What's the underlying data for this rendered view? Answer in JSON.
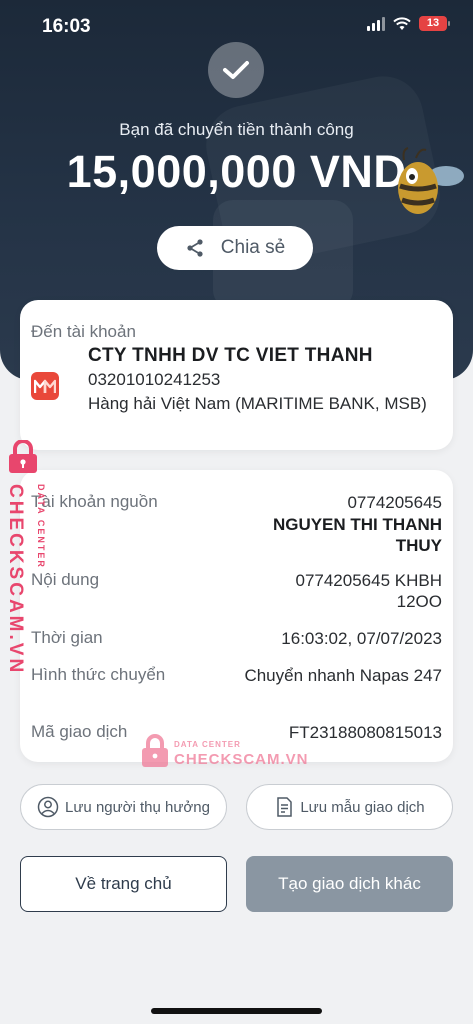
{
  "status_bar": {
    "time": "16:03",
    "battery": "13"
  },
  "header": {
    "success_message": "Bạn đã chuyển tiền thành công",
    "amount": "15,000,000 VND",
    "share_label": "Chia sẻ"
  },
  "recipient": {
    "label": "Đến tài khoản",
    "account_name": "CTY TNHH DV TC VIET THANH",
    "account_number": "03201010241253",
    "bank_name": "Hàng hải Việt Nam (MARITIME BANK, MSB)",
    "bank_logo_icon": "msb-bank-logo"
  },
  "details": {
    "source_account": {
      "label": "Tài khoản nguồn",
      "number": "0774205645",
      "name": "NGUYEN THI THANH THUY"
    },
    "content": {
      "label": "Nội dung",
      "value": "0774205645 KHBH 12OO"
    },
    "time": {
      "label": "Thời gian",
      "value": "16:03:02, 07/07/2023"
    },
    "method": {
      "label": "Hình thức chuyển",
      "value": "Chuyển nhanh Napas 247"
    },
    "transaction_id": {
      "label": "Mã giao dịch",
      "value": "FT23188080815013"
    }
  },
  "actions": {
    "save_beneficiary": "Lưu người thụ hưởng",
    "save_template": "Lưu mẫu giao dịch",
    "home": "Về trang chủ",
    "new_transaction": "Tạo giao dịch khác"
  },
  "watermark": {
    "brand": "CHECKSCAM.VN",
    "sub": "DATA CENTER"
  },
  "colors": {
    "header_bg": "#1c2939",
    "primary_dark": "#2f3c4c",
    "disabled_btn": "#8a96a2",
    "watermark": "#e8466d"
  }
}
